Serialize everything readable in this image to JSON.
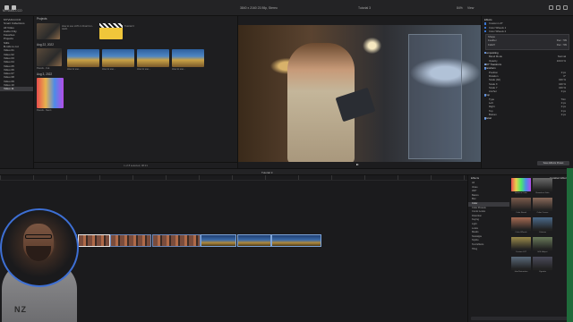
{
  "toolbar": {
    "library_label": "MYVIAN-CCO",
    "viewer_info": "3840 x 2160 23.98p, Stereo",
    "project_tab": "Tutorial 3",
    "zoom": "84%",
    "view_label": "View"
  },
  "sidebar": {
    "items": [
      {
        "label": "MYVIAN-CCO",
        "selected": false
      },
      {
        "label": "Smart Collections",
        "selected": false
      },
      {
        "label": "All Video",
        "selected": false
      },
      {
        "label": "Audio Only",
        "selected": false
      },
      {
        "label": "Favorites",
        "selected": false
      },
      {
        "label": "Projects",
        "selected": false
      },
      {
        "label": "Stills",
        "selected": false
      },
      {
        "label": "B-rolls to cut",
        "selected": false
      },
      {
        "label": "Video 01",
        "selected": false
      },
      {
        "label": "Video 02",
        "selected": false
      },
      {
        "label": "Video 03",
        "selected": false
      },
      {
        "label": "Video 04",
        "selected": false
      },
      {
        "label": "Video 05",
        "selected": false
      },
      {
        "label": "Video 06",
        "selected": false
      },
      {
        "label": "Video 07",
        "selected": false
      },
      {
        "label": "Video 08",
        "selected": false
      },
      {
        "label": "Video 09",
        "selected": false
      },
      {
        "label": "Video 10",
        "selected": false
      },
      {
        "label": "Video 11",
        "selected": true
      }
    ]
  },
  "browser": {
    "sections": {
      "projects": "Projects",
      "date1": "Aug 22, 2022",
      "date2": "Aug 3, 2022"
    },
    "captions": {
      "p1": "How to use LUTs in Final Cut - wedn.",
      "p2": "Tutorial 3",
      "c1": "Pexels - Cut.",
      "c2": "How to use...",
      "c3": "How to use...",
      "c4": "How to use...",
      "c5": "How to use...",
      "c6": "Pexels - Neon"
    },
    "footer": "1 of 8 selected, 08:21"
  },
  "inspector": {
    "title": "Effects",
    "rows": [
      {
        "label": "Custom LUT",
        "value": "",
        "checked": true,
        "head": true
      },
      {
        "label": "Color Wheels 1",
        "value": "",
        "checked": true,
        "head": false
      },
      {
        "label": "Color Wheels 2",
        "value": "",
        "checked": true,
        "head": false
      }
    ],
    "panel": {
      "label": "Shape",
      "rows": [
        {
          "label": "Feather",
          "value": "Rec. 709"
        },
        {
          "label": "Falloff",
          "value": "Rec. 709"
        }
      ]
    },
    "sections": [
      {
        "label": "Compositing",
        "value": "",
        "head": true
      },
      {
        "label": "Blend Mode",
        "value": "Normal",
        "head": false
      },
      {
        "label": "Opacity",
        "value": "100.0 %",
        "head": false
      },
      {
        "label": "360° Transform",
        "value": "",
        "head": true
      },
      {
        "label": "Transform",
        "value": "",
        "head": true
      },
      {
        "label": "Position",
        "value": "0 px",
        "head": false
      },
      {
        "label": "Rotation",
        "value": "0°",
        "head": false
      },
      {
        "label": "Scale (All)",
        "value": "100 %",
        "head": false
      },
      {
        "label": "Scale X",
        "value": "100 %",
        "head": false
      },
      {
        "label": "Scale Y",
        "value": "100 %",
        "head": false
      },
      {
        "label": "Anchor",
        "value": "0 px",
        "head": false
      },
      {
        "label": "Crop",
        "value": "",
        "head": true
      },
      {
        "label": "Type",
        "value": "Trim",
        "head": false
      },
      {
        "label": "Left",
        "value": "0 px",
        "head": false
      },
      {
        "label": "Right",
        "value": "0 px",
        "head": false
      },
      {
        "label": "Top",
        "value": "0 px",
        "head": false
      },
      {
        "label": "Bottom",
        "value": "0 px",
        "head": false
      },
      {
        "label": "Distort",
        "value": "",
        "head": true
      }
    ],
    "save_button": "Save Effects Preset"
  },
  "timeline": {
    "title": "Tutorial 3",
    "clips": [
      {
        "kind": "warm",
        "selected": false,
        "width": 0
      },
      {
        "kind": "warm",
        "selected": true,
        "width": 0
      },
      {
        "kind": "warm",
        "selected": false,
        "width": 0
      },
      {
        "kind": "warm",
        "selected": false,
        "width": 0
      },
      {
        "kind": "mtn",
        "selected": false,
        "width": 0
      },
      {
        "kind": "mtn",
        "selected": false,
        "width": 0
      },
      {
        "kind": "mtn",
        "selected": false,
        "width": 0
      }
    ]
  },
  "effects": {
    "title": "Effects",
    "scope": "Installed Effects",
    "categories": [
      {
        "label": "All",
        "selected": false
      },
      {
        "label": "Video",
        "selected": false
      },
      {
        "label": "360°",
        "selected": false
      },
      {
        "label": "Basics",
        "selected": false
      },
      {
        "label": "Blur",
        "selected": false
      },
      {
        "label": "Color",
        "selected": true
      },
      {
        "label": "Color Presets",
        "selected": false
      },
      {
        "label": "Comic Looks",
        "selected": false
      },
      {
        "label": "Distortion",
        "selected": false
      },
      {
        "label": "Keying",
        "selected": false
      },
      {
        "label": "Light",
        "selected": false
      },
      {
        "label": "Looks",
        "selected": false
      },
      {
        "label": "Masks",
        "selected": false
      },
      {
        "label": "Nostalgia",
        "selected": false
      },
      {
        "label": "Stylize",
        "selected": false
      },
      {
        "label": "Text Effects",
        "selected": false
      },
      {
        "label": "Tiling",
        "selected": false
      }
    ],
    "items": [
      {
        "label": "Balance Color",
        "color": "#e05a7a"
      },
      {
        "label": "Broadcast Safe",
        "color": "#6a6a6a"
      },
      {
        "label": "Color Board",
        "color": "#7a5a4a"
      },
      {
        "label": "Color Curves",
        "color": "#8a6a5a"
      },
      {
        "label": "Color Wheels",
        "color": "#a46a52"
      },
      {
        "label": "Colorize",
        "color": "#4a6a8a"
      },
      {
        "label": "Custom LUT",
        "color": "#9a8a4a"
      },
      {
        "label": "HSL Adjust",
        "color": "#6a7a5a"
      },
      {
        "label": "Hue/Saturation",
        "color": "#5a6a7a"
      },
      {
        "label": "Vignette",
        "color": "#4a4a5a"
      }
    ]
  },
  "webcam": {
    "shirt_text": "NZ"
  }
}
